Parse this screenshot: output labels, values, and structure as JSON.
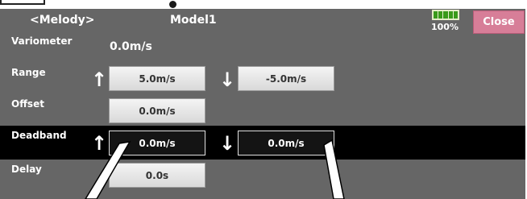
{
  "header": {
    "menu_title": "<Melody>",
    "model_name": "Model1",
    "battery_percent": "100%",
    "battery_level": 1.0,
    "close_label": "Close"
  },
  "rows": {
    "variometer": {
      "label": "Variometer",
      "value": "0.0m/s"
    },
    "range": {
      "label": "Range",
      "up_value": "5.0m/s",
      "down_value": "-5.0m/s"
    },
    "offset": {
      "label": "Offset",
      "value": "0.0m/s"
    },
    "deadband": {
      "label": "Deadband",
      "up_value": "0.0m/s",
      "down_value": "0.0m/s"
    },
    "delay": {
      "label": "Delay",
      "value": "0.0s"
    }
  },
  "icons": {
    "up": "↑",
    "down": "↓",
    "battery": "battery-icon",
    "callout_pointer": "callout-pointer"
  },
  "colors": {
    "screen_bg": "#666666",
    "close_button": "#d77e98",
    "battery_fill": "#3a9a1a",
    "selected_row": "#000000"
  }
}
